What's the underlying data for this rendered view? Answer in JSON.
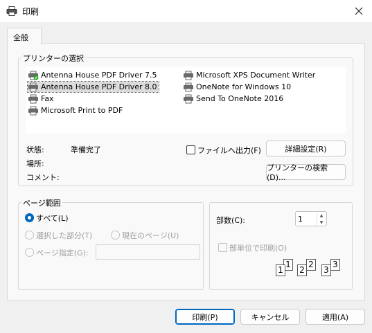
{
  "window": {
    "title": "印刷",
    "icon": "printer-icon",
    "close_icon": "close-icon"
  },
  "tabs": [
    {
      "label": "全般",
      "active": true
    }
  ],
  "printer_group": {
    "legend": "プリンターの選択",
    "printers": [
      {
        "name": "Antenna House PDF Driver 7.5",
        "selected": false,
        "default": true
      },
      {
        "name": "Antenna House PDF Driver 8.0",
        "selected": true,
        "default": false
      },
      {
        "name": "Fax",
        "selected": false,
        "default": false
      },
      {
        "name": "Microsoft Print to PDF",
        "selected": false,
        "default": false
      },
      {
        "name": "Microsoft XPS Document Writer",
        "selected": false,
        "default": false
      },
      {
        "name": "OneNote for Windows 10",
        "selected": false,
        "default": false
      },
      {
        "name": "Send To OneNote 2016",
        "selected": false,
        "default": false
      }
    ],
    "status_label": "状態:",
    "status_value": "準備完了",
    "location_label": "場所:",
    "location_value": "",
    "comment_label": "コメント:",
    "comment_value": "",
    "print_to_file_label": "ファイルへ出力(F)",
    "print_to_file_checked": false,
    "preferences_button": "詳細設定(R)",
    "find_printer_button": "プリンターの検索(D)..."
  },
  "page_range": {
    "legend": "ページ範囲",
    "all_label": "すべて(L)",
    "selection_label": "選択した部分(T)",
    "current_page_label": "現在のページ(U)",
    "pages_label": "ページ指定(G):",
    "pages_value": "",
    "selected": "all"
  },
  "copies": {
    "label": "部数(C):",
    "value": "1",
    "collate_label": "部単位で印刷(O)",
    "collate_checked": false,
    "collate_pages": [
      "1",
      "1",
      "2",
      "2",
      "3",
      "3"
    ]
  },
  "buttons": {
    "print": "印刷(P)",
    "cancel": "キャンセル",
    "apply": "適用(A)"
  },
  "colors": {
    "accent": "#0067c0",
    "window_bg": "#f0f0f0",
    "panel_bg": "#f9f9f9",
    "selection_bg": "#dcdcdc",
    "default_printer_check": "#2aa52a"
  }
}
